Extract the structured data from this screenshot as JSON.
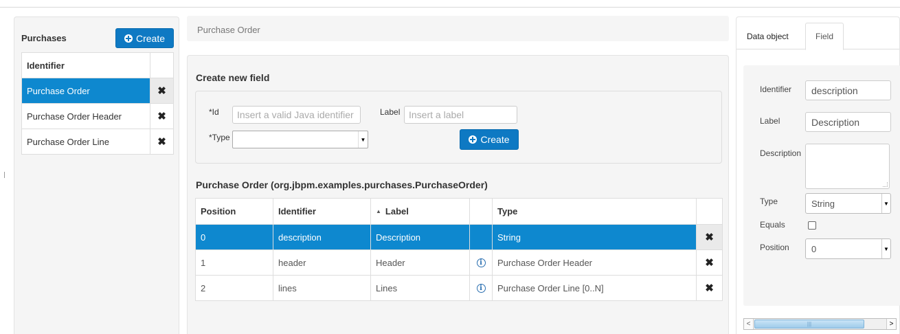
{
  "left_panel": {
    "title": "Purchases",
    "create_label": "Create",
    "column_header": "Identifier",
    "items": [
      {
        "label": "Purchase Order",
        "selected": true
      },
      {
        "label": "Purchase Order Header",
        "selected": false
      },
      {
        "label": "Purchase Order Line",
        "selected": false
      }
    ]
  },
  "breadcrumb": "Purchase Order",
  "create_form": {
    "title": "Create new field",
    "id_label": "*Id",
    "id_placeholder": "Insert a valid Java identifier",
    "label_label": "Label",
    "label_placeholder": "Insert a label",
    "type_label": "*Type",
    "type_value": "",
    "create_label": "Create"
  },
  "fields_table": {
    "title": "Purchase Order (org.jbpm.examples.purchases.PurchaseOrder)",
    "headers": [
      "Position",
      "Identifier",
      "Label",
      "",
      "Type",
      ""
    ],
    "sort_indicator": "▲",
    "rows": [
      {
        "position": "0",
        "identifier": "description",
        "label": "Description",
        "info": false,
        "type": "String",
        "selected": true
      },
      {
        "position": "1",
        "identifier": "header",
        "label": "Header",
        "info": true,
        "type": "Purchase Order Header",
        "selected": false
      },
      {
        "position": "2",
        "identifier": "lines",
        "label": "Lines",
        "info": true,
        "type": "Purchase Order Line [0..N]",
        "selected": false
      }
    ]
  },
  "right_panel": {
    "tabs": [
      "Data object",
      "Field"
    ],
    "active_tab": "Field",
    "identifier_label": "Identifier",
    "identifier_value": "description",
    "label_label": "Label",
    "label_value": "Description",
    "description_label": "Description",
    "type_label": "Type",
    "type_value": "String",
    "equals_label": "Equals",
    "position_label": "Position",
    "position_value": "0"
  },
  "icons": {
    "create": "plus-circle-icon",
    "delete": "close-icon",
    "info": "info-icon"
  },
  "colors": {
    "primary": "#0e79c3",
    "selected_row": "#0e88cf",
    "panel_bg": "#f5f5f5"
  }
}
